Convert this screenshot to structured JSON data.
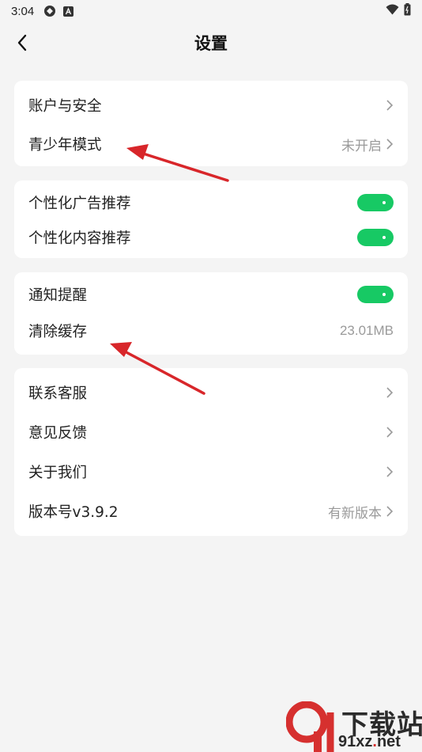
{
  "status_bar": {
    "time": "3:04"
  },
  "header": {
    "title": "设置"
  },
  "groups": [
    {
      "items": [
        {
          "label": "账户与安全",
          "value": "",
          "control": "chevron"
        },
        {
          "label": "青少年模式",
          "value": "未开启",
          "control": "chevron"
        }
      ]
    },
    {
      "items": [
        {
          "label": "个性化广告推荐",
          "control": "toggle",
          "on": true
        },
        {
          "label": "个性化内容推荐",
          "control": "toggle",
          "on": true
        }
      ]
    },
    {
      "items": [
        {
          "label": "通知提醒",
          "control": "toggle",
          "on": true
        },
        {
          "label": "清除缓存",
          "value": "23.01MB",
          "control": "value"
        }
      ]
    },
    {
      "items": [
        {
          "label": "联系客服",
          "control": "chevron"
        },
        {
          "label": "意见反馈",
          "control": "chevron"
        },
        {
          "label": "关于我们",
          "control": "chevron"
        },
        {
          "label": "版本号v3.9.2",
          "value": "有新版本",
          "control": "chevron"
        }
      ]
    }
  ],
  "watermark": {
    "brand_cn": "下载站",
    "domain_part1": "91xz",
    "domain_dot": ".",
    "domain_part2": "net"
  },
  "colors": {
    "toggle_on": "#17c964",
    "annotation_arrow": "#d8262a",
    "page_background": "#f4f4f4"
  }
}
